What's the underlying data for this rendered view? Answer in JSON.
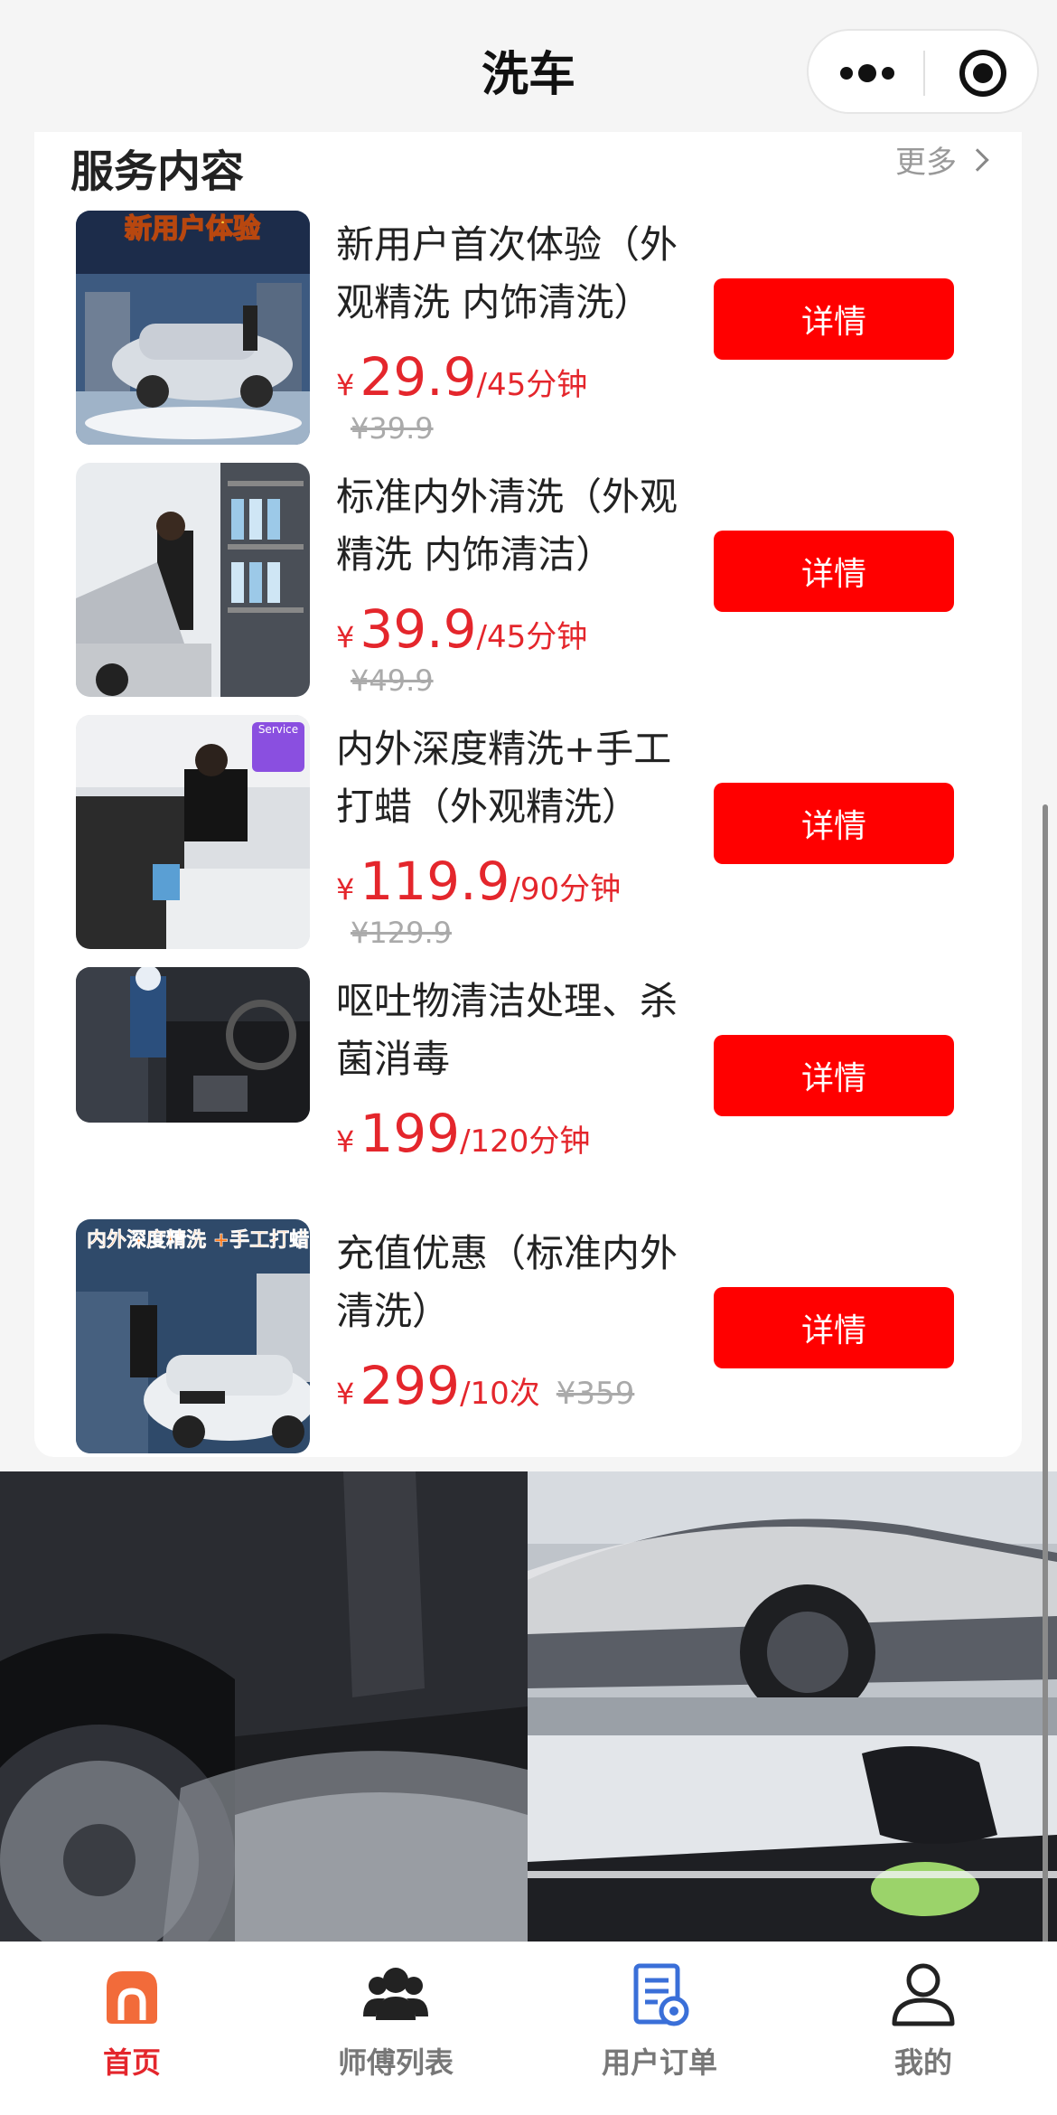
{
  "header": {
    "title": "洗车"
  },
  "section": {
    "title": "服务内容",
    "more": "更多"
  },
  "services": [
    {
      "name": "新用户首次体验（外观精洗 内饰清洗）",
      "currency": "¥",
      "price": "29.9",
      "unit": "/45分钟",
      "original": "¥39.9",
      "button": "详情",
      "badge": "新用户体验"
    },
    {
      "name": "标准内外清洗（外观精洗 内饰清洁）",
      "currency": "¥",
      "price": "39.9",
      "unit": "/45分钟",
      "original": "¥49.9",
      "button": "详情"
    },
    {
      "name": "内外深度精洗+手工打蜡（外观精洗）",
      "currency": "¥",
      "price": "119.9",
      "unit": "/90分钟",
      "original": "¥129.9",
      "button": "详情",
      "badge": "Service"
    },
    {
      "name": "呕吐物清洁处理、杀菌消毒",
      "currency": "¥",
      "price": "199",
      "unit": "/120分钟",
      "original": "",
      "button": "详情"
    },
    {
      "name": "充值优惠（标准内外清洗）",
      "currency": "¥",
      "price": "299",
      "unit": "/10次",
      "original": "¥359",
      "button": "详情",
      "badge": "内外深度精洗 +手工打蜡"
    }
  ],
  "tabbar": [
    {
      "label": "首页",
      "icon": "home-icon",
      "active": true
    },
    {
      "label": "师傅列表",
      "icon": "people-icon",
      "active": false
    },
    {
      "label": "用户订单",
      "icon": "order-icon",
      "active": false
    },
    {
      "label": "我的",
      "icon": "user-icon",
      "active": false
    }
  ],
  "colors": {
    "accent": "#e4262c",
    "button": "#ff0000",
    "home_tab": "#f26b3a",
    "order_tab": "#3a6fd8"
  }
}
